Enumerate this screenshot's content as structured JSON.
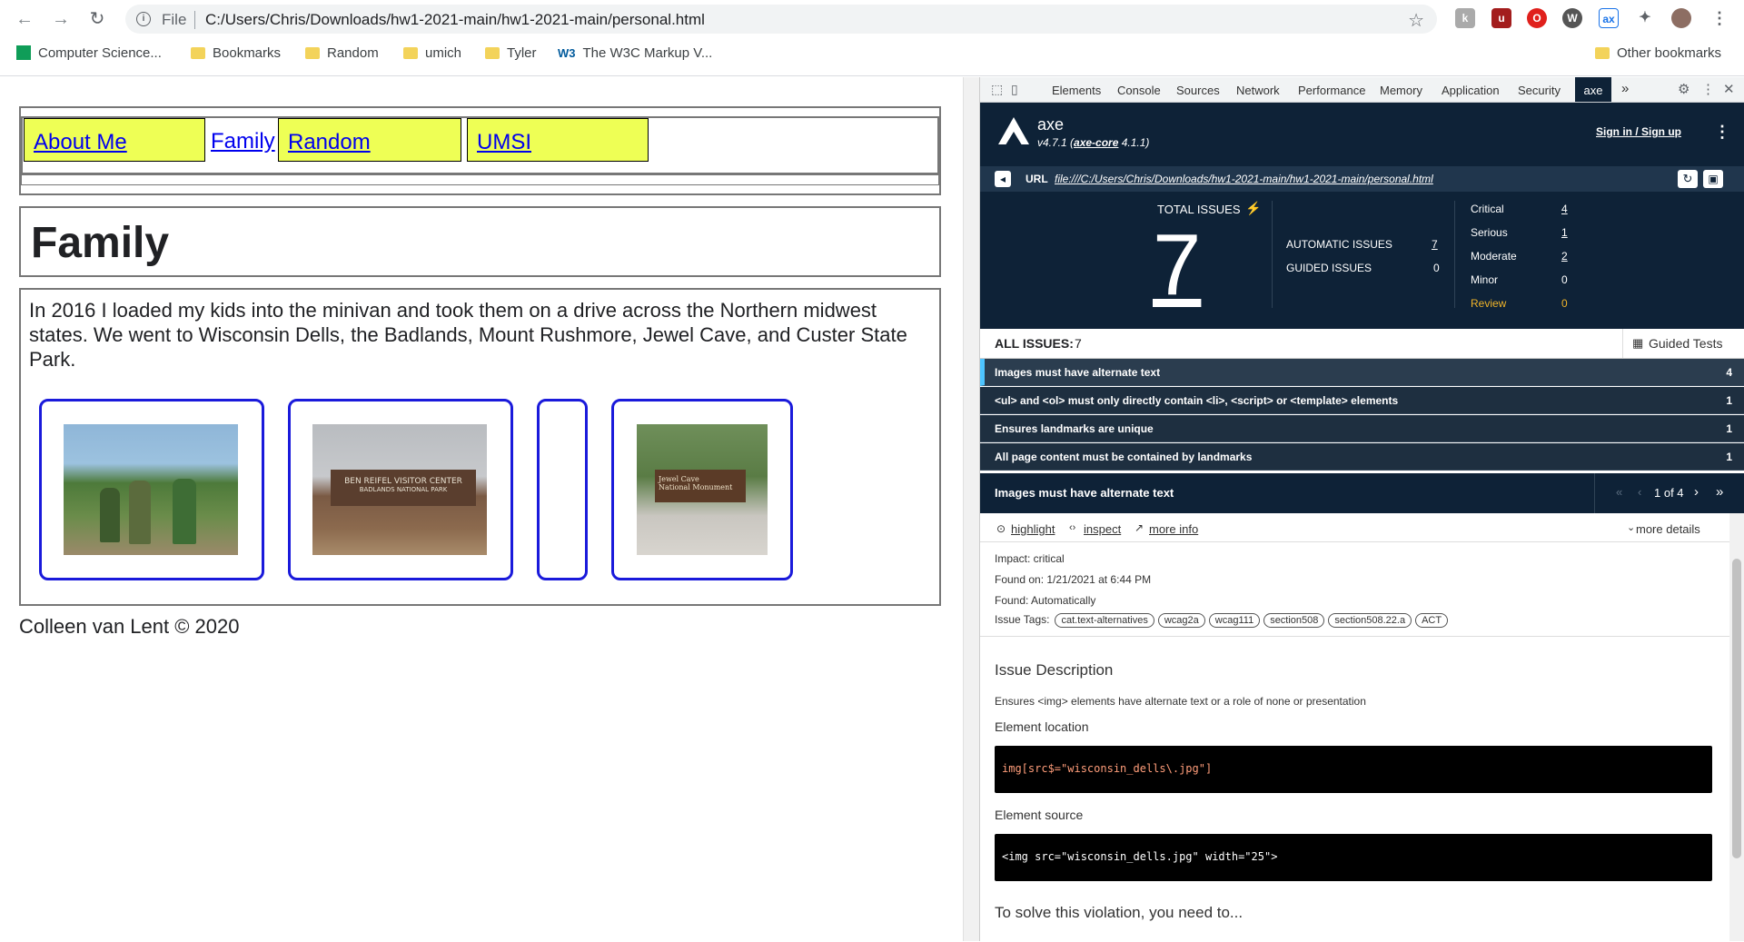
{
  "browser": {
    "file_label": "File",
    "url": "C:/Users/Chris/Downloads/hw1-2021-main/hw1-2021-main/personal.html",
    "bookmarks": [
      "Computer Science...",
      "Bookmarks",
      "Random",
      "umich",
      "Tyler",
      "The W3C Markup V..."
    ],
    "other_bookmarks": "Other bookmarks"
  },
  "page": {
    "nav": [
      "About Me",
      "Family",
      "Random",
      "UMSI"
    ],
    "title": "Family",
    "paragraph": "In 2016 I loaded my kids into the minivan and took them on a drive across the Northern midwest states. We went to Wisconsin Dells, the Badlands, Mount Rushmore, Jewel Cave, and Custer State Park.",
    "photo_texts": {
      "badlands_line1": "BEN REIFEL VISITOR CENTER",
      "badlands_line2": "BADLANDS NATIONAL PARK",
      "jewel_line1": "Jewel Cave",
      "jewel_line2": "National Monument"
    },
    "footer": "Colleen van Lent © 2020"
  },
  "devtools": {
    "tabs": [
      "Elements",
      "Console",
      "Sources",
      "Network",
      "Performance",
      "Memory",
      "Application",
      "Security",
      "axe"
    ],
    "more_tabs": "»",
    "axe": {
      "name": "axe",
      "version_prefix": "v4.7.1 (",
      "version_link": "axe-core",
      "version_suffix": " 4.1.1)",
      "signin": "Sign in / Sign up",
      "url_label": "URL",
      "url": "file:///C:/Users/Chris/Downloads/hw1-2021-main/hw1-2021-main/personal.html",
      "total_label": "TOTAL ISSUES",
      "total": "7",
      "automatic_label": "AUTOMATIC ISSUES",
      "automatic": "7",
      "guided_label": "GUIDED ISSUES",
      "guided": "0",
      "severity": [
        {
          "label": "Critical",
          "value": "4"
        },
        {
          "label": "Serious",
          "value": "1"
        },
        {
          "label": "Moderate",
          "value": "2"
        },
        {
          "label": "Minor",
          "value": "0"
        },
        {
          "label": "Review",
          "value": "0"
        }
      ],
      "all_issues_label": "ALL ISSUES:",
      "all_issues_count": "7",
      "guided_tests": "Guided Tests",
      "issues": [
        {
          "text": "Images must have alternate text",
          "count": "4"
        },
        {
          "text": "<ul> and <ol> must only directly contain <li>, <script> or <template> elements",
          "count": "1"
        },
        {
          "text": "Ensures landmarks are unique",
          "count": "1"
        },
        {
          "text": "All page content must be contained by landmarks",
          "count": "1"
        }
      ],
      "selected_title": "Images must have alternate text",
      "pager": "1 of 4",
      "actions": [
        "highlight",
        "inspect",
        "more info"
      ],
      "more_details": "more details",
      "impact": "Impact: critical",
      "found_on": "Found on: 1/21/2021 at 6:44 PM",
      "found": "Found: Automatically",
      "tags_label": "Issue Tags:",
      "tags": [
        "cat.text-alternatives",
        "wcag2a",
        "wcag111",
        "section508",
        "section508.22.a",
        "ACT"
      ],
      "desc_heading": "Issue Description",
      "desc": "Ensures <img> elements have alternate text or a role of none or presentation",
      "loc_heading": "Element location",
      "loc_code": "img[src$=\"wisconsin_dells\\.jpg\"]",
      "src_heading": "Element source",
      "src_code": "<img src=\"wisconsin_dells.jpg\" width=\"25\">",
      "solve": "To solve this violation, you need to..."
    }
  },
  "colors": {
    "axe_dark": "#0e2237",
    "nav_yellow": "#eeff55",
    "frame_blue": "#1a1adb",
    "review_orange": "#f0b429"
  }
}
